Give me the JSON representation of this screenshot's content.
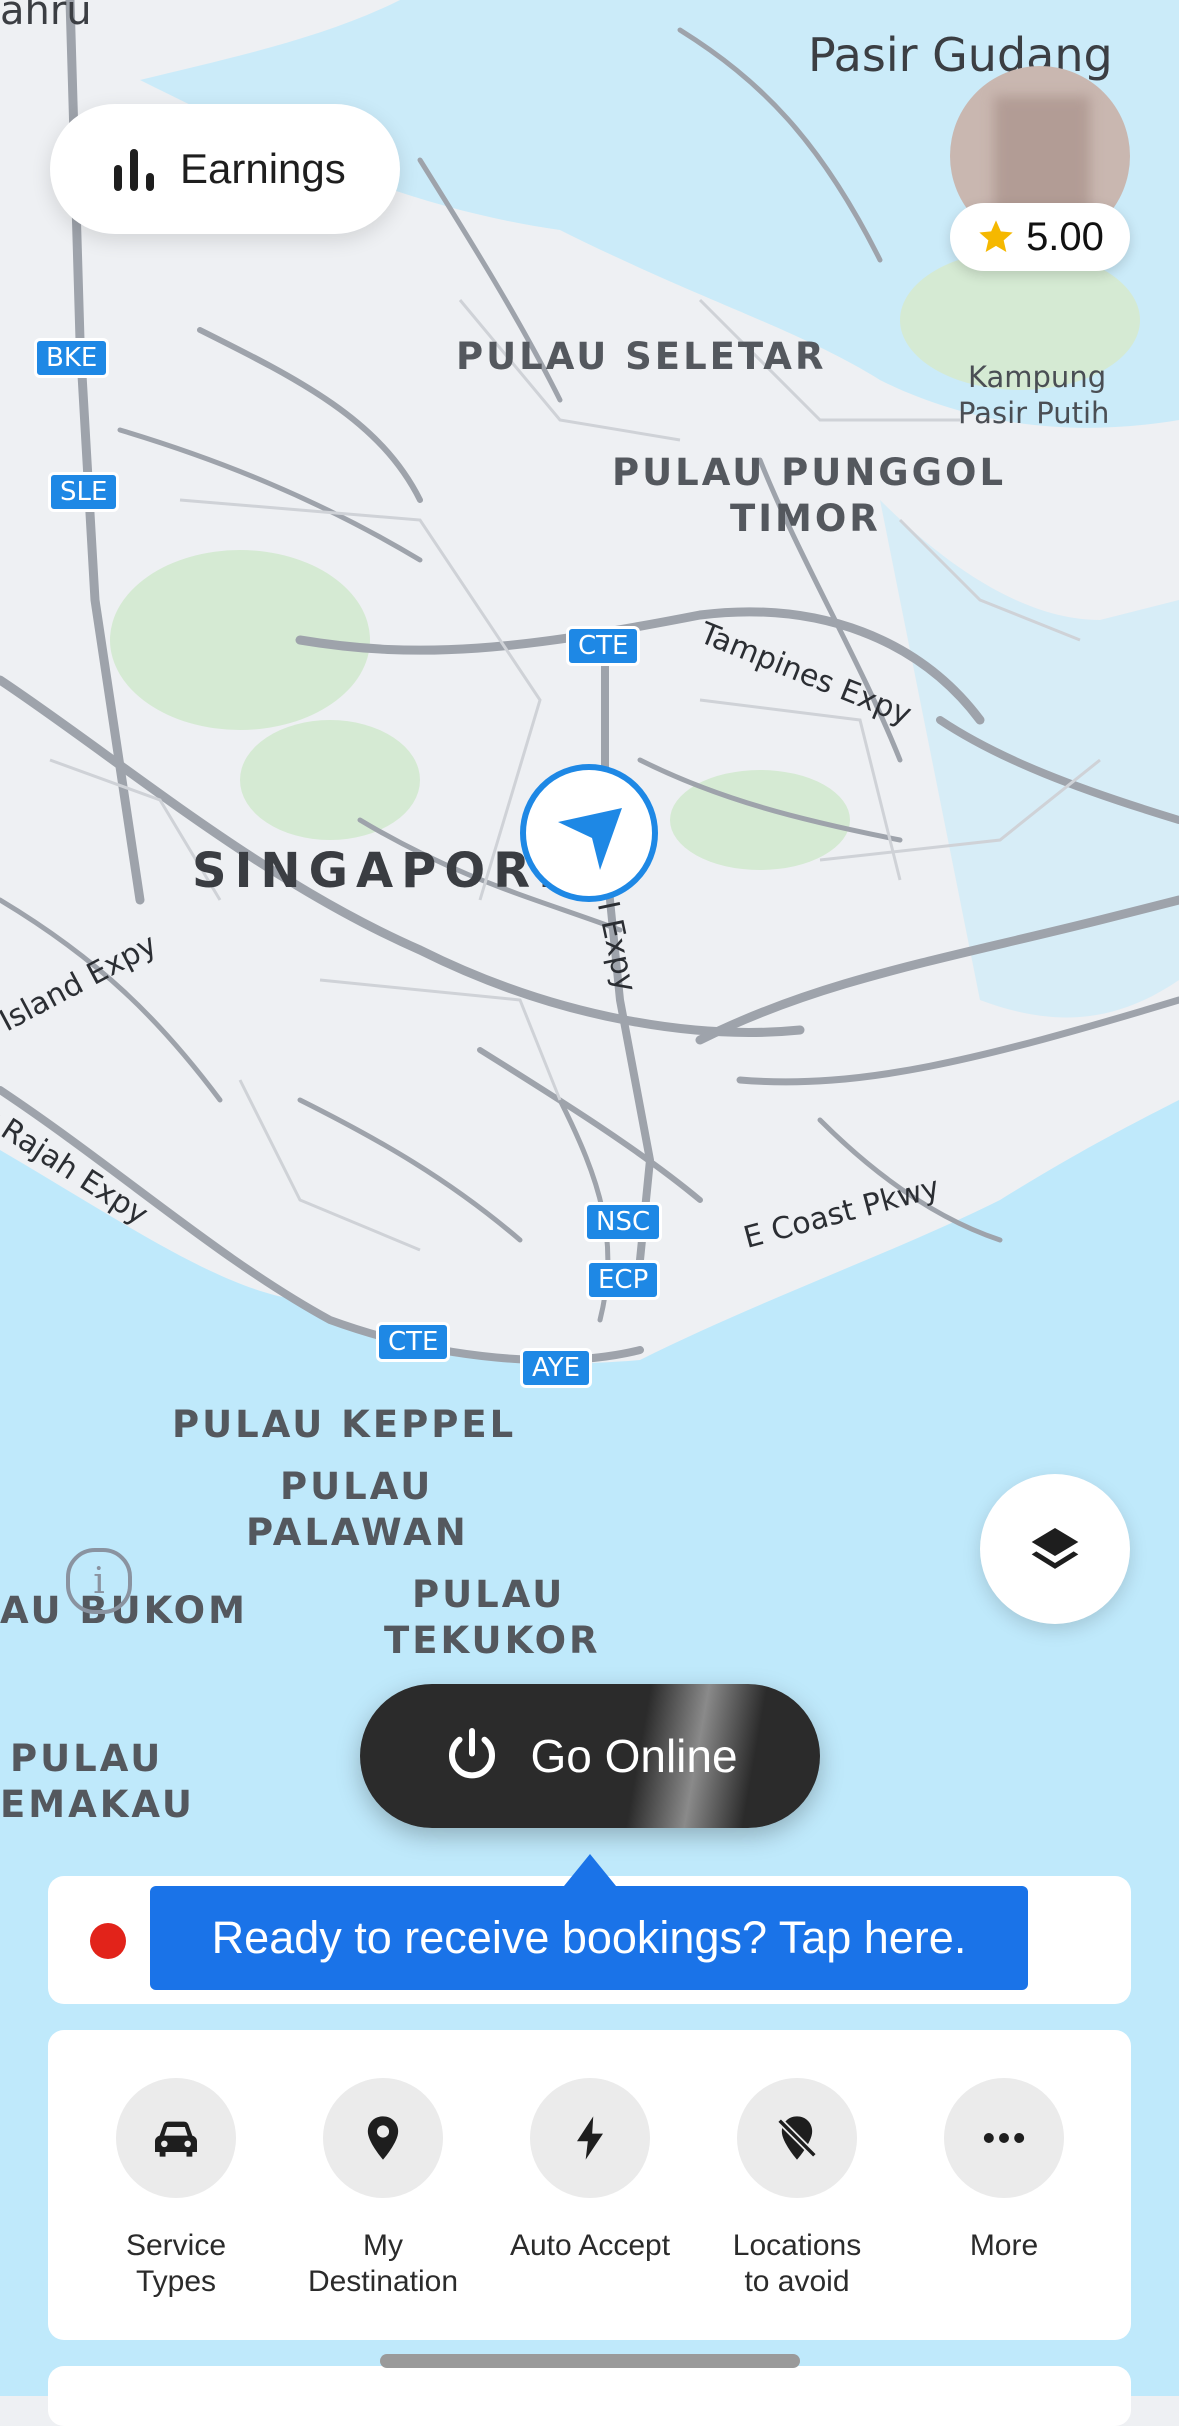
{
  "map": {
    "place_labels": {
      "top_left_partial": "ahru",
      "pasir_gudang": "Pasir Gudang",
      "pulau_seletar": "PULAU SELETAR",
      "kampung": "Kampung",
      "pasir_putih": "Pasir Putih",
      "pulau_punggol_1": "PULAU PUNGGOL",
      "pulau_punggol_2": "TIMOR",
      "singapore": "SINGAPORE",
      "pulau_keppel": "PULAU KEPPEL",
      "pulau_palawan_1": "PULAU",
      "pulau_palawan_2": "PALAWAN",
      "pulau_bukom": "AU BUKOM",
      "pulau_tekukor_1": "PULAU",
      "pulau_tekukor_2": "TEKUKOR",
      "pulau_semakau_1": "PULAU",
      "pulau_semakau_2": "EMAKAU"
    },
    "road_labels": {
      "tampines": "Tampines Expy",
      "island": "Island Expy",
      "rajah": "or Rajah Expy",
      "ecoast": "E Coast Pkwy",
      "cte_expy": "I Expy"
    },
    "shields": {
      "bke": "BKE",
      "sle": "SLE",
      "cte_top": "CTE",
      "nsc": "NSC",
      "ecp": "ECP",
      "cte_bottom": "CTE",
      "aye": "AYE"
    },
    "colors": {
      "land": "#eef0f3",
      "water": "#bfe9fb",
      "park": "#d5ead3",
      "road": "#9ea3ab",
      "accent": "#1a73e8"
    }
  },
  "header": {
    "earnings_label": "Earnings",
    "rating": "5.00"
  },
  "go_online": {
    "label": "Go Online"
  },
  "status": {
    "tooltip": "Ready to receive bookings? Tap here."
  },
  "actions": [
    {
      "label_1": "Service",
      "label_2": "Types",
      "icon": "car-icon"
    },
    {
      "label_1": "My",
      "label_2": "Destination",
      "icon": "location-pin-icon"
    },
    {
      "label_1": "Auto Accept",
      "label_2": "",
      "icon": "lightning-icon"
    },
    {
      "label_1": "Locations",
      "label_2": "to avoid",
      "icon": "no-location-icon"
    },
    {
      "label_1": "More",
      "label_2": "",
      "icon": "more-icon"
    }
  ]
}
